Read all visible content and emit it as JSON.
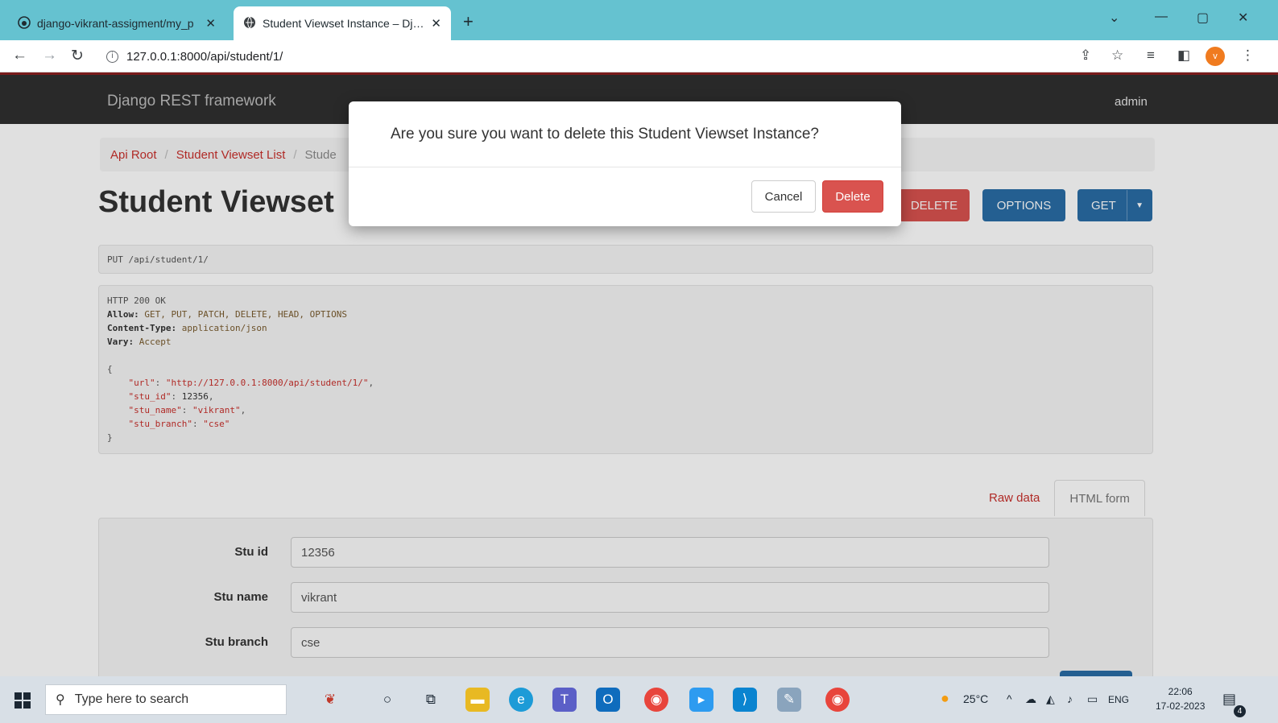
{
  "browser": {
    "tabs": [
      {
        "title": "django-vikrant-assigment/my_p",
        "close": "✕"
      },
      {
        "title": "Student Viewset Instance – Djang",
        "close": "✕"
      }
    ],
    "new_tab": "+",
    "url": "127.0.0.1:8000/api/student/1/"
  },
  "navbar": {
    "brand": "Django REST framework",
    "user": "admin"
  },
  "breadcrumb": {
    "items": [
      "Api Root",
      "Student Viewset List"
    ],
    "current": "Stude",
    "separator": "/"
  },
  "page": {
    "title": "Student Viewset",
    "buttons": {
      "delete": "DELETE",
      "options": "OPTIONS",
      "get": "GET"
    }
  },
  "request_info": "PUT /api/student/1/",
  "response": {
    "status": "HTTP 200 OK",
    "headers": [
      {
        "name": "Allow:",
        "value": "GET, PUT, PATCH, DELETE, HEAD, OPTIONS"
      },
      {
        "name": "Content-Type:",
        "value": "application/json"
      },
      {
        "name": "Vary:",
        "value": "Accept"
      }
    ],
    "body": {
      "open": "{",
      "close": "}",
      "lines": [
        {
          "key": "\"url\"",
          "value": "\"http://127.0.0.1:8000/api/student/1/\"",
          "type": "str",
          "comma": ","
        },
        {
          "key": "\"stu_id\"",
          "value": "12356",
          "type": "num",
          "comma": ","
        },
        {
          "key": "\"stu_name\"",
          "value": "\"vikrant\"",
          "type": "str",
          "comma": ","
        },
        {
          "key": "\"stu_branch\"",
          "value": "\"cse\"",
          "type": "str",
          "comma": ""
        }
      ]
    }
  },
  "form_tabs": {
    "raw": "Raw data",
    "html": "HTML form"
  },
  "form": {
    "fields": [
      {
        "label": "Stu id",
        "value": "12356"
      },
      {
        "label": "Stu name",
        "value": "vikrant"
      },
      {
        "label": "Stu branch",
        "value": "cse"
      }
    ]
  },
  "modal": {
    "message": "Are you sure you want to delete this Student Viewset Instance?",
    "cancel": "Cancel",
    "delete": "Delete"
  },
  "taskbar": {
    "search_placeholder": "Type here to search",
    "weather": "25°C",
    "language": "ENG",
    "time": "22:06",
    "date": "17-02-2023",
    "notification_count": "4"
  },
  "colors": {
    "brand_red": "#c9302c",
    "primary_blue": "#2a6da6",
    "danger": "#d9534f",
    "navbar": "#2f2f2f",
    "tabbar": "#65c2d0"
  }
}
